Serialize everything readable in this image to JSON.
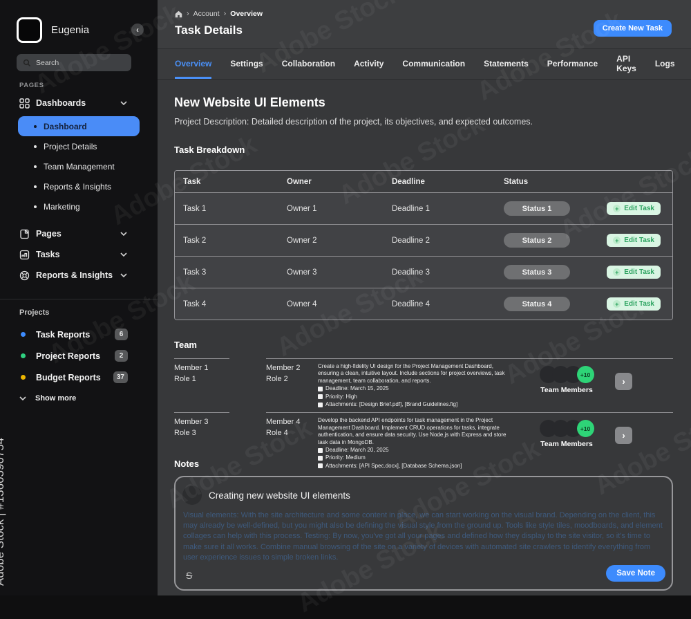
{
  "watermark": {
    "stock": "Adobe Stock",
    "id": "Adobe Stock | #1360590754"
  },
  "icons": {
    "collapse": "‹",
    "home": "⌂",
    "crumb_sep": "›",
    "chevron_right": "›",
    "plus": "+",
    "strike": "S"
  },
  "sidebar": {
    "logo_text": "Eugenia",
    "search_placeholder": "Search",
    "pages_label": "PAGES",
    "groups": [
      {
        "label": "Dashboards"
      },
      {
        "label": "Pages"
      },
      {
        "label": "Tasks"
      },
      {
        "label": "Reports & Insights"
      }
    ],
    "dashboards_children": [
      {
        "label": "Dashboard"
      },
      {
        "label": "Project Details"
      },
      {
        "label": "Team Management"
      },
      {
        "label": "Reports & Insights"
      },
      {
        "label": "Marketing"
      }
    ],
    "projects_label": "Projects",
    "projects": [
      {
        "label": "Task Reports",
        "badge": "6",
        "dot_color": "#3d8bfd"
      },
      {
        "label": "Project Reports",
        "badge": "2",
        "dot_color": "#2fd080"
      },
      {
        "label": "Budget Reports",
        "badge": "37",
        "dot_color": "#edb600"
      }
    ],
    "show_more_label": "Show more"
  },
  "header": {
    "breadcrumb": [
      "Account",
      "Overview"
    ],
    "title": "Task Details",
    "create_task_label": "Create New Task"
  },
  "tabs": {
    "items": [
      "Overview",
      "Settings",
      "Collaboration",
      "Activity",
      "Communication",
      "Statements",
      "Performance",
      "API Keys",
      "Logs"
    ],
    "active": "Overview"
  },
  "overview": {
    "project_title": "New Website UI Elements",
    "project_description": "Project Description: Detailed description of the project, its objectives, and expected outcomes.",
    "task_section_heading": "Task Breakdown",
    "task_table": {
      "columns": [
        "Task",
        "Owner",
        "Deadline",
        "Status"
      ],
      "edit_label": "Edit Task",
      "rows": [
        {
          "task": "Task 1",
          "owner": "Owner 1",
          "deadline": "Deadline 1",
          "status": "Status 1"
        },
        {
          "task": "Task 2",
          "owner": "Owner 2",
          "deadline": "Deadline 2",
          "status": "Status 2"
        },
        {
          "task": "Task 3",
          "owner": "Owner 3",
          "deadline": "Deadline 3",
          "status": "Status 3"
        },
        {
          "task": "Task 4",
          "owner": "Owner 4",
          "deadline": "Deadline 4",
          "status": "Status 4"
        }
      ]
    },
    "team_section_heading": "Team",
    "team_rows": [
      {
        "member_a_name": "Member 1",
        "member_a_role": "Role 1",
        "member_b_name": "Member 2",
        "member_b_role": "Role 2",
        "description": "Create a high-fidelity UI design for the Project Management Dashboard, ensuring a clean, intuitive layout. Include sections for project overviews, task management, team collaboration, and reports.",
        "deadline": "Deadline: March 15, 2025",
        "priority": "Priority: High",
        "attachments": "Attachments: [Design Brief.pdf], [Brand Guidelines.fig]",
        "overflow_badge": "+10",
        "members_label": "Team Members"
      },
      {
        "member_a_name": "Member 3",
        "member_a_role": "Role 3",
        "member_b_name": "Member 4",
        "member_b_role": "Role 4",
        "description": "Develop the backend API endpoints for task management in the Project Management Dashboard. Implement CRUD operations for tasks, integrate authentication, and ensure data security. Use Node.js with Express and store task data in MongoDB.",
        "deadline": "Deadline: March 20, 2025",
        "priority": "Priority: Medium",
        "attachments": "Attachments: [API Spec.docx], [Database Schema.json]",
        "overflow_badge": "+10",
        "members_label": "Team Members"
      }
    ],
    "notes_section_heading": "Notes",
    "notes": {
      "title": "Creating new website UI elements",
      "body": "Visual elements: With the site architecture and some content in place, we can start working on the visual brand. Depending on the client, this may already be well-defined, but you might also be defining the visual style from the ground up. Tools like style tiles, moodboards, and element collages can help with this process. Testing: By now, you've got all your pages and defined how they display to the site visitor, so it's time to make sure it all works. Combine manual browsing of the site on a variety of devices with automated site crawlers to identify everything from user experience issues to simple broken links.",
      "save_label": "Save Note"
    }
  },
  "colors": {
    "accent_blue": "#3d8bfd",
    "active_item_blue": "#4a8cf7",
    "tab_active_blue": "#4a90f7",
    "mint_button_bg": "#d9f5e3",
    "mint_button_text": "#2ba35f",
    "overflow_badge_green": "#2ed477",
    "status_pill_gray": "#6f7072",
    "sidebar_bg": "#121214",
    "header_bg": "#3d3e40",
    "content_bg": "#37383a",
    "note_body_text": "#3e5a7d"
  }
}
